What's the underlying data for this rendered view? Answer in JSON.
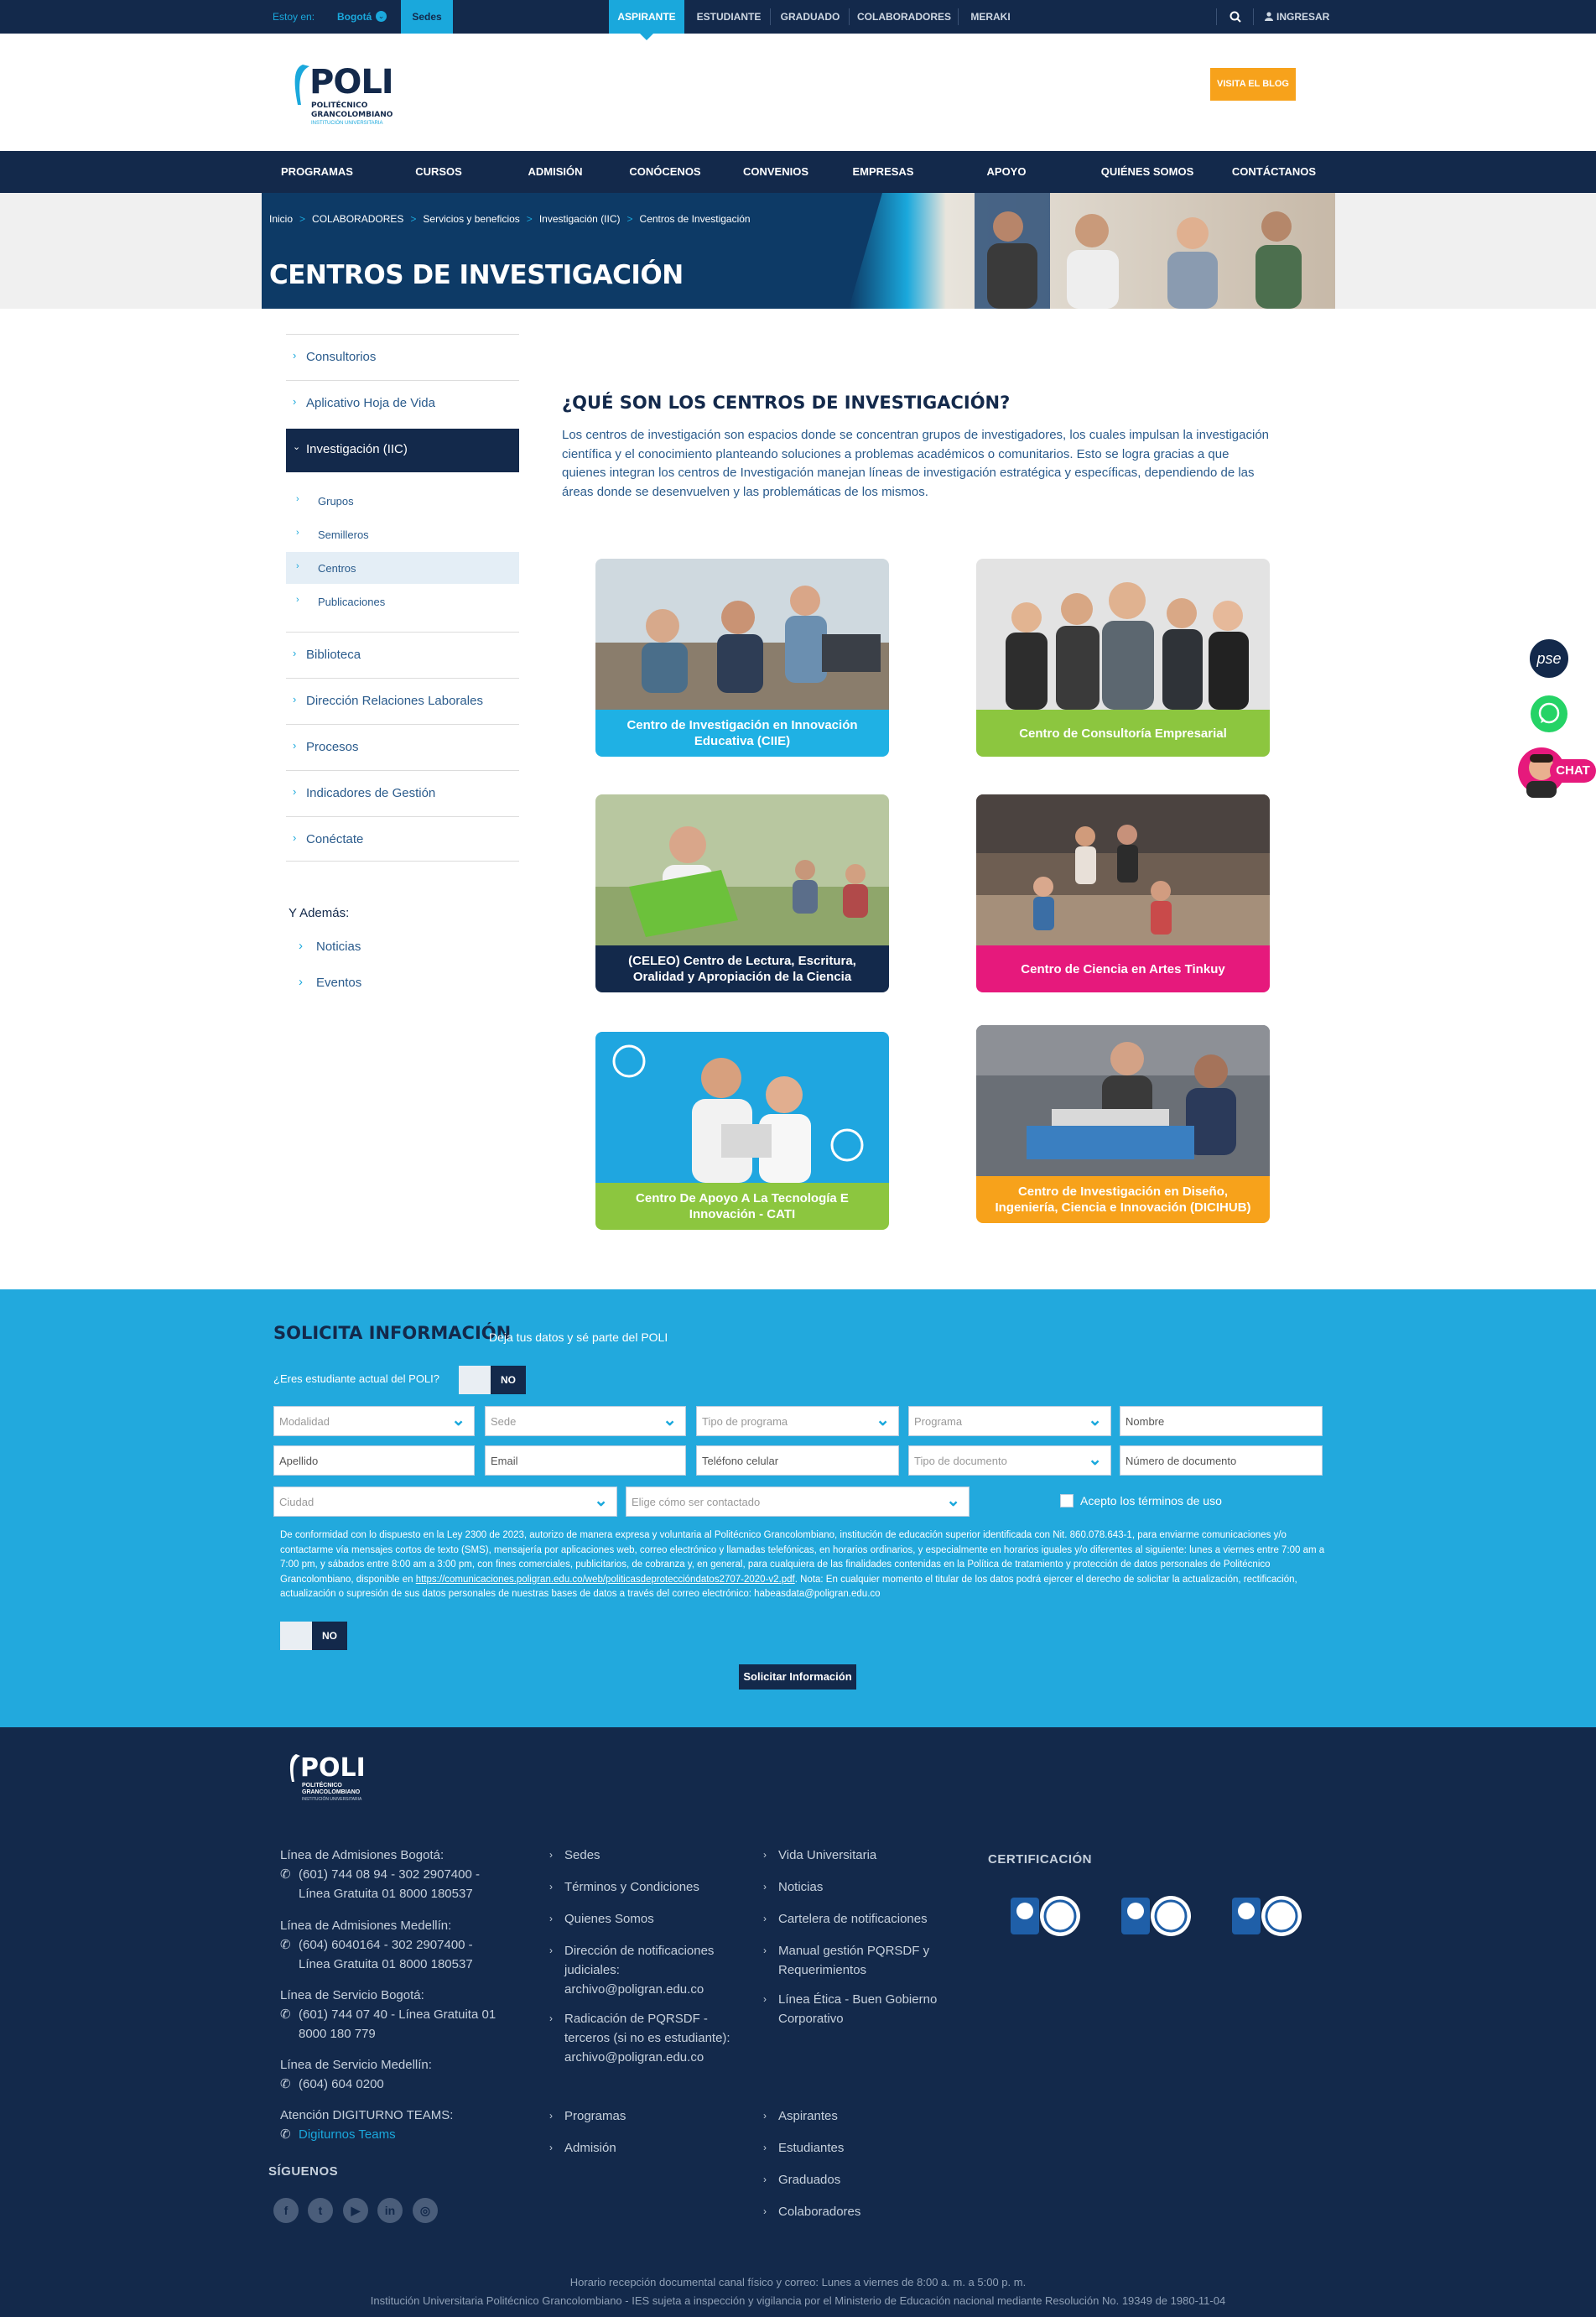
{
  "topbar": {
    "estoy_en": "Estoy en:",
    "city": "Bogotá",
    "sedes": "Sedes",
    "tabs": [
      "ASPIRANTE",
      "ESTUDIANTE",
      "GRADUADO",
      "COLABORADORES",
      "MERAKI"
    ],
    "login": "INGRESAR"
  },
  "header": {
    "logo_main": "POLI",
    "logo_line1": "POLITÉCNICO",
    "logo_line2": "GRANCOLOMBIANO",
    "logo_line3": "INSTITUCIÓN UNIVERSITARIA",
    "blog_button": "VISITA EL BLOG"
  },
  "mainnav": [
    "PROGRAMAS",
    "CURSOS CORTOS",
    "ADMISIÓN",
    "CONÓCENOS",
    "CONVENIOS",
    "EMPRESAS",
    "APOYO FINANCIERO",
    "QUIÉNES SOMOS",
    "CONTÁCTANOS"
  ],
  "breadcrumb": [
    "Inicio",
    "COLABORADORES",
    "Servicios y beneficios",
    "Investigación (IIC)",
    "Centros de Investigación"
  ],
  "page_title": "CENTROS DE INVESTIGACIÓN",
  "sidebar": {
    "items_top": [
      "Consultorios",
      "Aplicativo Hoja de Vida"
    ],
    "active": "Investigación (IIC)",
    "subitems": [
      "Grupos",
      "Semilleros",
      "Centros",
      "Publicaciones"
    ],
    "items_bottom": [
      "Biblioteca",
      "Dirección Relaciones Laborales",
      "Procesos",
      "Indicadores de Gestión",
      "Conéctate"
    ],
    "ademas_title": "Y Además:",
    "ademas": [
      "Noticias",
      "Eventos"
    ]
  },
  "content": {
    "title": "¿QUÉ SON LOS CENTROS DE INVESTIGACIÓN?",
    "text": "Los centros de investigación son espacios donde se concentran grupos de investigadores, los cuales impulsan la investigación científica y el conocimiento planteando soluciones a problemas académicos o comunitarios. Esto se logra gracias a que quienes integran los centros de Investigación manejan líneas de investigación estratégica y específicas, dependiendo de las áreas donde se desenvuelven y las problemáticas de los mismos."
  },
  "cards": [
    {
      "label": "Centro de Investigación en Innovación Educativa (CIIE)",
      "color": "#1fb1e4"
    },
    {
      "label": "Centro de Consultoría Empresarial",
      "color": "#8cc63f"
    },
    {
      "label": "(CELEO) Centro de Lectura, Escritura, Oralidad y Apropiación de la Ciencia",
      "color": "#13294b"
    },
    {
      "label": "Centro de Ciencia en Artes Tinkuy",
      "color": "#e6197c"
    },
    {
      "label": "Centro De Apoyo A La Tecnología E Innovación - CATI",
      "color": "#8cc63f"
    },
    {
      "label": "Centro de Investigación en Diseño, Ingeniería, Ciencia e Innovación (DICIHUB)",
      "color": "#f7a21b"
    }
  ],
  "form": {
    "title": "SOLICITA INFORMACIÓN",
    "subtitle": "Deja tus datos y sé parte del POLI",
    "question": "¿Eres estudiante actual del POLI?",
    "toggle_no": "NO",
    "row1": [
      "Modalidad",
      "Sede",
      "Tipo de programa",
      "Programa",
      "Nombre"
    ],
    "row2": [
      "Apellido",
      "Email",
      "Teléfono celular",
      "Tipo de documento",
      "Número de documento"
    ],
    "ciudad": "Ciudad",
    "contacto": "Elige cómo ser contactado",
    "terms": "Acepto los términos de uso",
    "legal_text": "De conformidad con lo dispuesto en la Ley 2300 de 2023, autorizo de manera expresa y voluntaria al Politécnico Grancolombiano, institución de educación superior identificada con Nit. 860.078.643-1, para enviarme comunicaciones y/o contactarme vía mensajes cortos de texto (SMS), mensajería por aplicaciones web, correo electrónico y llamadas telefónicas, en horarios ordinarios, y especialmente en horarios iguales y/o diferentes al siguiente: lunes a viernes entre 7:00 am a 7:00 pm, y sábados entre 8:00 am a 3:00 pm, con fines comerciales, publicitarios, de cobranza y, en general, para cualquiera de las finalidades contenidas en la Política de tratamiento y protección de datos personales de Politécnico Grancolombiano, disponible en",
    "legal_link": "https://comunicaciones.poligran.edu.co/web/politicasdeproteccióndatos2707-2020-v2.pdf",
    "legal_text2": ". Nota: En cualquier momento el titular de los datos podrá ejercer el derecho de solicitar la actualización, rectificación, actualización o supresión de sus datos personales de nuestras bases de datos a través del correo electrónico: habeasdata@poligran.edu.co",
    "submit": "Solicitar Información"
  },
  "footer": {
    "contacts": [
      {
        "label": "Línea de Admisiones Bogotá:",
        "value": "(601) 744 08 94 - 302 2907400 - Línea Gratuita 01 8000 180537"
      },
      {
        "label": "Línea de Admisiones Medellín:",
        "value": "(604) 6040164 - 302 2907400 - Línea Gratuita 01 8000 180537"
      },
      {
        "label": "Línea de Servicio Bogotá:",
        "value": "(601) 744 07 40 - Línea Gratuita 01 8000 180 779"
      },
      {
        "label": "Línea de Servicio Medellín:",
        "value": "(604) 604 0200"
      },
      {
        "label": "Atención DIGITURNO TEAMS:",
        "value": "Digiturnos Teams"
      }
    ],
    "siguenos": "SÍGUENOS",
    "col2": [
      "Sedes",
      "Términos y Condiciones",
      "Quienes Somos",
      "Dirección de notificaciones judiciales: archivo@poligran.edu.co",
      "Radicación de PQRSDF - terceros (si no es estudiante): archivo@poligran.edu.co"
    ],
    "col2b": [
      "Programas",
      "Admisión"
    ],
    "col3": [
      "Vida Universitaria",
      "Noticias",
      "Cartelera de notificaciones",
      "Manual gestión PQRSDF y Requerimientos",
      "Línea Ética - Buen Gobierno Corporativo"
    ],
    "col3b": [
      "Aspirantes",
      "Estudiantes",
      "Graduados",
      "Colaboradores"
    ],
    "certificacion": "CERTIFICACIÓN",
    "bottom1": "Horario recepción documental canal físico y correo: Lunes a viernes de 8:00 a. m. a 5:00 p. m.",
    "bottom2": "Institución Universitaria Politécnico Grancolombiano - IES sujeta a inspección y vigilancia por el Ministerio de Educación nacional mediante Resolución No. 19349 de 1980-11-04"
  },
  "floating": {
    "pse": "pse",
    "chat": "CHAT"
  }
}
